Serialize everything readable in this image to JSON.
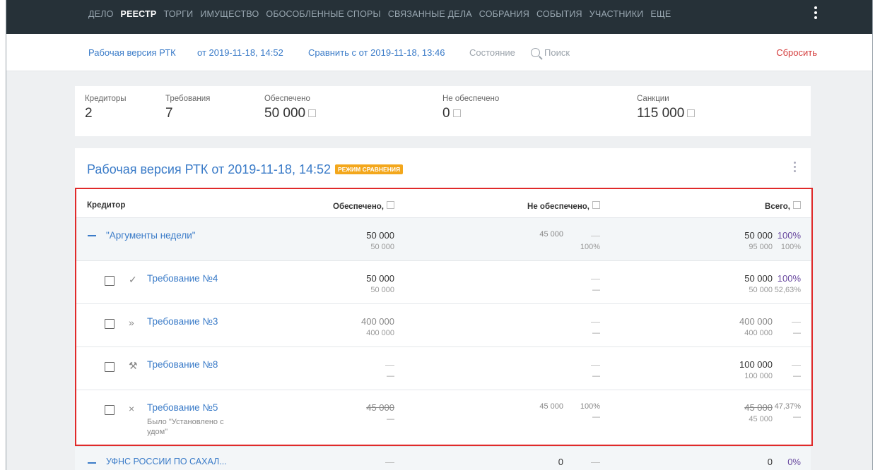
{
  "nav": {
    "items": [
      "Дело",
      "Реестр",
      "Торги",
      "Имущество",
      "Обособленные споры",
      "Связанные дела",
      "Собрания",
      "События",
      "Участники",
      "Еще"
    ],
    "active_index": 1
  },
  "toolbar": {
    "version_link": "Рабочая версия РТК",
    "date_link": "от 2019-11-18, 14:52",
    "compare_link": "Сравнить с от 2019-11-18, 13:46",
    "state_label": "Состояние",
    "search_placeholder": "Поиск",
    "reset_label": "Сбросить"
  },
  "summary": {
    "creditors": {
      "label": "Кредиторы",
      "value": "2"
    },
    "claims": {
      "label": "Требования",
      "value": "7"
    },
    "secured": {
      "label": "Обеспечено",
      "value": "50 000"
    },
    "unsecured": {
      "label": "Не обеспечено",
      "value": "0"
    },
    "sanctions": {
      "label": "Санкции",
      "value": "115 000"
    }
  },
  "panel": {
    "title": "Рабочая версия РТК от 2019-11-18, 14:52",
    "badge": "Режим сравнения"
  },
  "table": {
    "headers": {
      "creditor": "Кредитор",
      "secured": "Обеспечено,",
      "unsecured": "Не обеспечено,",
      "total": "Всего,"
    },
    "rows": [
      {
        "name": "\"Аргументы недели\"",
        "secured": "50 000",
        "secured_sub": "50 000",
        "unsec": "45 000",
        "unsec_pct": "—",
        "unsec_pct_sub": "100%",
        "total": "50 000",
        "total_sub": "95 000",
        "pct": "100%",
        "pct_sub": "100%"
      },
      {
        "name": "Требование №4",
        "icon": "✓",
        "secured": "50 000",
        "secured_sub": "50 000",
        "unsec": "—",
        "unsec_sub": "—",
        "total": "50 000",
        "total_sub": "50 000",
        "pct": "100%",
        "pct_sub": "52,63%"
      },
      {
        "name": "Требование №3",
        "icon": "»",
        "secured": "400 000",
        "secured_sub": "400 000",
        "unsec": "—",
        "unsec_sub": "—",
        "total": "400 000",
        "total_sub": "400 000",
        "pct": "—",
        "pct_sub": "—"
      },
      {
        "name": "Требование №8",
        "icon": "⚒",
        "secured": "—",
        "secured_sub": "—",
        "unsec": "—",
        "unsec_sub": "—",
        "total": "100 000",
        "total_sub": "100 000",
        "pct": "—",
        "pct_sub": "—"
      },
      {
        "name": "Требование №5",
        "icon": "×",
        "note": "Было \"Установлено с удом\"",
        "secured": "45 000",
        "secured_sub": "—",
        "unsec": "45 000",
        "unsec_pct": "100%",
        "unsec_pct_sub": "—",
        "total": "45 000",
        "total_sub": "45 000",
        "pct": "47,37%",
        "pct_sub": "—"
      },
      {
        "name": "УФНС РОССИИ ПО САХАЛ...",
        "secured": "—",
        "unsec": "0",
        "unsec_pct": "—",
        "total": "0",
        "pct": "0%"
      }
    ]
  }
}
